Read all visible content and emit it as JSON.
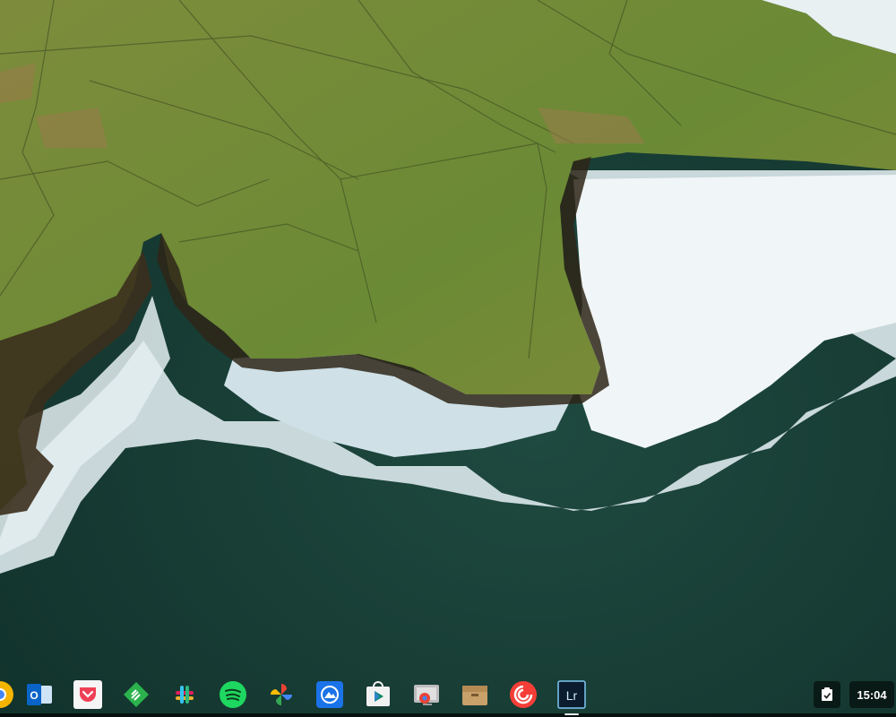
{
  "desktop": {
    "wallpaper": "aerial-cliffs-ocean",
    "colors": {
      "ocean": "#163a33",
      "surf": "#e9f2f4",
      "grass": "#6f8a3a",
      "cliff": "#3b2f1d"
    }
  },
  "shelf": {
    "apps": [
      {
        "name": "chrome",
        "icon": "chrome-icon",
        "color": "#f4b400"
      },
      {
        "name": "outlook",
        "icon": "outlook-icon",
        "color": "#0a64c8",
        "label": "O"
      },
      {
        "name": "pocket",
        "icon": "pocket-icon",
        "color": "#ef4056"
      },
      {
        "name": "feedly",
        "icon": "feedly-icon",
        "color": "#2bb24c"
      },
      {
        "name": "slack",
        "icon": "slack-icon",
        "color": "#e01e5a"
      },
      {
        "name": "spotify",
        "icon": "spotify-icon",
        "color": "#1ed760"
      },
      {
        "name": "google-photos",
        "icon": "pinwheel-icon",
        "color": "#fbbc05"
      },
      {
        "name": "photo-app",
        "icon": "photo-app-icon",
        "color": "#1a73e8"
      },
      {
        "name": "play-store",
        "icon": "play-store-icon",
        "color": "#01875f"
      },
      {
        "name": "chrome-remote-desktop",
        "icon": "remote-desktop-icon",
        "color": "#bdbdbd"
      },
      {
        "name": "archive",
        "icon": "archive-box-icon",
        "color": "#c8a06a"
      },
      {
        "name": "pocket-casts",
        "icon": "pocket-casts-icon",
        "color": "#f43e37"
      },
      {
        "name": "lightroom",
        "icon": "lightroom-icon",
        "color": "#0a1c2e",
        "label": "Lr"
      }
    ]
  },
  "status_area": {
    "tray_icon": "clipboard-check-icon",
    "time": "15:04"
  }
}
